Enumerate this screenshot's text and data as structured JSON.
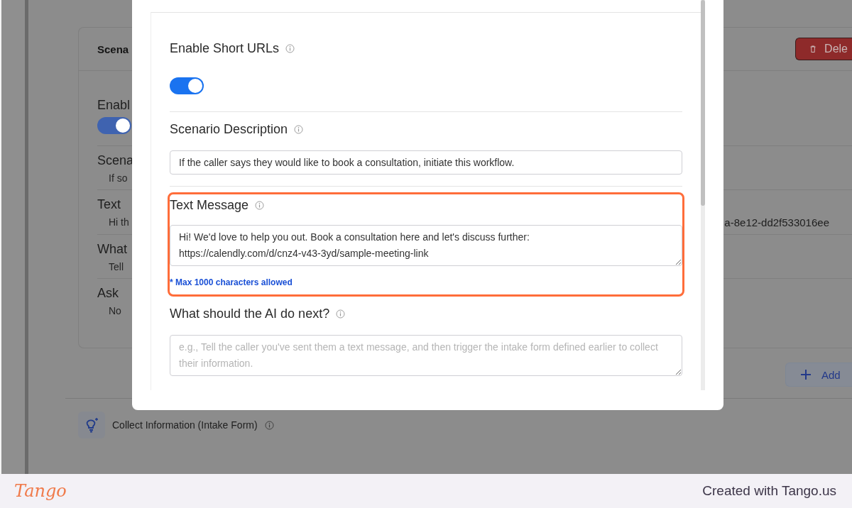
{
  "background": {
    "card_title": "Scena",
    "delete_button": "Dele",
    "rows": [
      {
        "kind": "toggle",
        "label": "Enabl",
        "on": true
      },
      {
        "kind": "text",
        "label": "Scena",
        "value": "If so"
      },
      {
        "kind": "text",
        "label": "Text",
        "value": "Hi th",
        "value_end": "a-8e12-dd2f533016ee"
      },
      {
        "kind": "text",
        "label": "What",
        "value": "Tell"
      },
      {
        "kind": "text",
        "label": "Ask",
        "value": "No"
      }
    ],
    "add_button": "Add",
    "section_label": "Collect Information (Intake Form)"
  },
  "dialog": {
    "fields": [
      {
        "kind": "toggle",
        "label": "Enable Short URLs",
        "on": true
      },
      {
        "kind": "input",
        "label": "Scenario Description",
        "value": "If the caller says they would like to book a consultation, initiate this workflow."
      },
      {
        "kind": "textarea",
        "label": "Text Message",
        "value": "Hi! We'd love to help you out. Book a consultation here and let's discuss further:\nhttps://calendly.com/d/cnz4-v43-3yd/sample-meeting-link",
        "note": "* Max 1000 characters allowed",
        "highlighted": true
      },
      {
        "kind": "textarea",
        "label": "What should the AI do next?",
        "placeholder": "e.g., Tell the caller you've sent them a text message, and then trigger the intake form defined earlier to collect their information."
      }
    ]
  },
  "footer": {
    "logo": "Tango",
    "credit": "Created with Tango.us"
  }
}
